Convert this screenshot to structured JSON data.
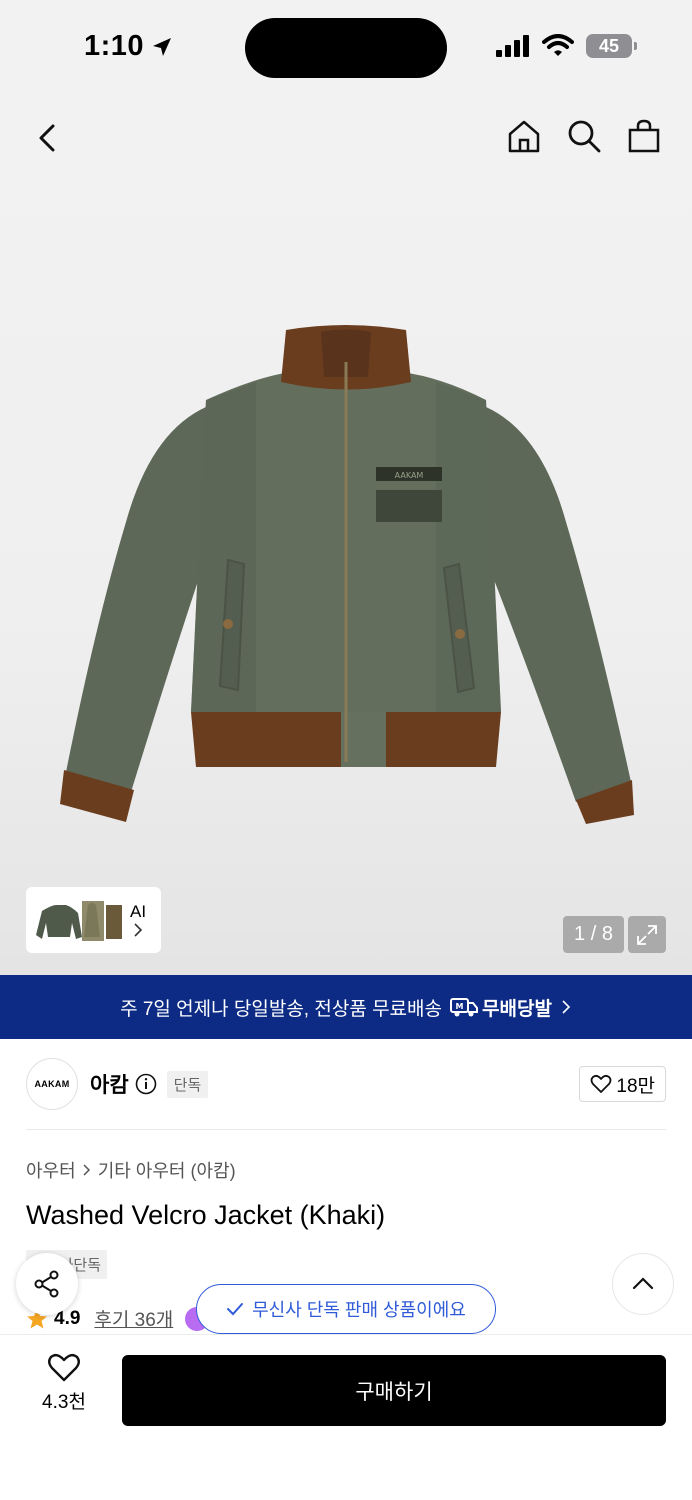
{
  "status_bar": {
    "time": "1:10",
    "battery": "45"
  },
  "gallery": {
    "thumb_label": "AI",
    "counter": "1 / 8"
  },
  "banner": {
    "text": "주 7일 언제나 당일발송, 전상품 무료배송",
    "brand": "무배당발"
  },
  "brand": {
    "logo_text": "AAKAM",
    "name": "아캄",
    "tag": "단독",
    "likes": "18만"
  },
  "breadcrumb": {
    "category": "아우터",
    "subcategory": "기타 아우터 (아캄)"
  },
  "product": {
    "title": "Washed Velcro Jacket (Khaki)",
    "exclusive_badge": "무신사단독",
    "rating": "4.9",
    "reviews": "후기 36개"
  },
  "toast": {
    "text": "무신사 단독 판매 상품이에요"
  },
  "bottom": {
    "wish_count": "4.3천",
    "buy_label": "구매하기"
  },
  "colors": {
    "banner_bg": "#0d2b85",
    "toast_accent": "#2f5bd8",
    "star": "#f5a623",
    "jacket_body": "#5f6a59",
    "jacket_rib": "#6b3d1f"
  }
}
